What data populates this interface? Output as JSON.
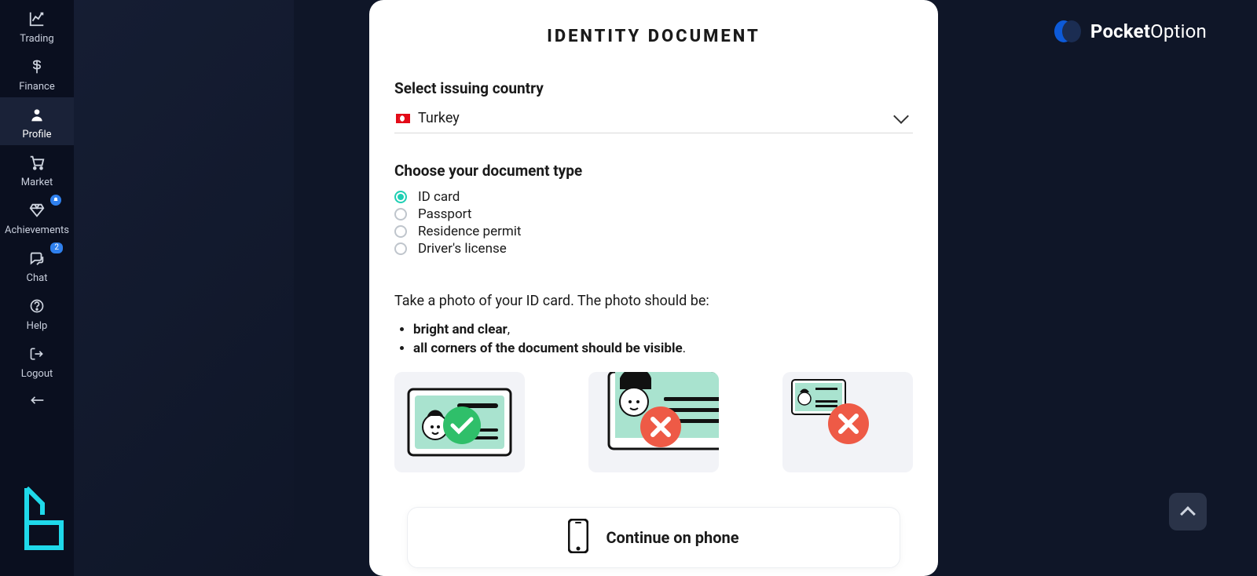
{
  "brand": {
    "bold": "Pocket",
    "light": "Option"
  },
  "sidebar": {
    "items": [
      {
        "label": "Trading"
      },
      {
        "label": "Finance"
      },
      {
        "label": "Profile"
      },
      {
        "label": "Market"
      },
      {
        "label": "Achievements",
        "badge_icon": "bell"
      },
      {
        "label": "Chat",
        "badge": "2"
      },
      {
        "label": "Help"
      },
      {
        "label": "Logout"
      }
    ]
  },
  "modal": {
    "title": "IDENTITY DOCUMENT",
    "country_label": "Select issuing country",
    "country_value": "Turkey",
    "doctype_label": "Choose your document type",
    "doctypes": [
      {
        "label": "ID card",
        "selected": true
      },
      {
        "label": "Passport",
        "selected": false
      },
      {
        "label": "Residence permit",
        "selected": false
      },
      {
        "label": "Driver's license",
        "selected": false
      }
    ],
    "instruction": "Take a photo of your ID card. The photo should be:",
    "bullets": [
      {
        "bold": "bright and clear",
        "tail": ","
      },
      {
        "bold": "all corners of the document should be visible",
        "tail": "."
      }
    ],
    "continue_label": "Continue on phone"
  }
}
